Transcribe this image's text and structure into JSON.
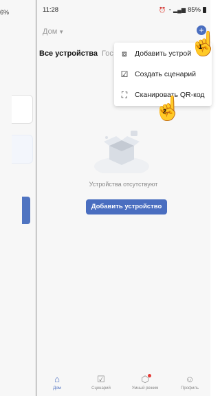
{
  "left_panel": {
    "battery_fragment": "6%"
  },
  "status_bar": {
    "time": "11:28",
    "battery": "85%"
  },
  "header": {
    "home_label": "Дом",
    "add_icon": "plus-circle-icon"
  },
  "tabs": {
    "all_devices": "Все устройства",
    "guest_partial": "Гос"
  },
  "menu": {
    "items": [
      {
        "label": "Добавить устрой",
        "icon": "device-add-icon"
      },
      {
        "label": "Создать сценарий",
        "icon": "scenario-add-icon"
      },
      {
        "label": "Сканировать QR-код",
        "icon": "scan-qr-icon"
      }
    ]
  },
  "annotations": {
    "hand1_number": "1",
    "hand2_number": "2"
  },
  "empty_state": {
    "text": "Устройства отсутствуют",
    "button": "Добавить устройство"
  },
  "bottom_nav": [
    {
      "label": "Дом",
      "icon": "home-icon",
      "active": true
    },
    {
      "label": "Сценарий",
      "icon": "scenario-icon",
      "active": false
    },
    {
      "label": "Умный режим",
      "icon": "smart-icon",
      "active": false
    },
    {
      "label": "Профиль",
      "icon": "profile-icon",
      "active": false
    }
  ],
  "colors": {
    "accent": "#4a6ec0",
    "background": "#f7f7f7",
    "badge": "#e53935"
  }
}
